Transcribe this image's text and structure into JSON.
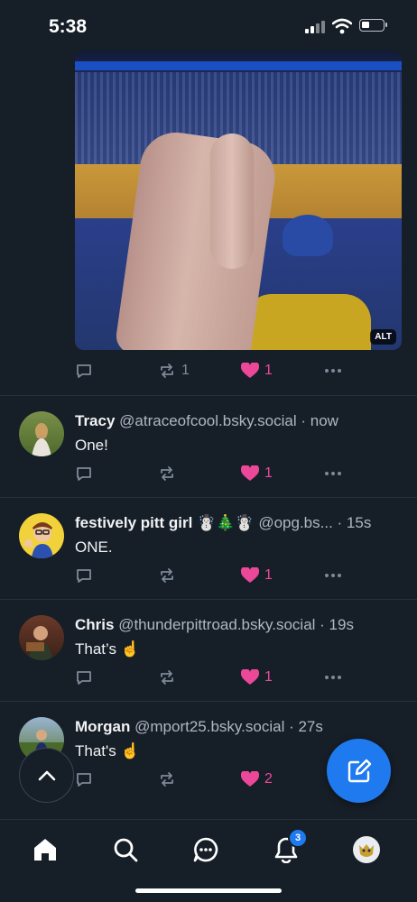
{
  "status_bar": {
    "time": "5:38"
  },
  "media": {
    "alt_badge": "ALT"
  },
  "top_post": {
    "reposts": "1",
    "likes": "1"
  },
  "replies": [
    {
      "name": "Tracy",
      "handle": "@atraceofcool.bsky.social",
      "time": "· now",
      "text": "One!",
      "likes": "1"
    },
    {
      "name": "festively pitt girl ☃️🎄☃️",
      "handle": "@opg.bs...",
      "time": "· 15s",
      "text": "ONE.",
      "likes": "1"
    },
    {
      "name": "Chris",
      "handle": "@thunderpittroad.bsky.social",
      "time": "· 19s",
      "text": "That’s ☝️",
      "likes": "1"
    },
    {
      "name": "Morgan",
      "handle": "@mport25.bsky.social",
      "time": "· 27s",
      "text": "That's ☝️",
      "likes": "2"
    }
  ],
  "nav": {
    "notifications_badge": "3"
  },
  "colors": {
    "background": "#161e27",
    "accent": "#1f7af0",
    "like": "#ec4899",
    "muted": "#7d8a99"
  },
  "icons": [
    "reply-icon",
    "repost-icon",
    "heart-icon",
    "more-icon",
    "compose-icon",
    "scroll-up-icon",
    "home-icon",
    "search-icon",
    "chat-icon",
    "bell-icon",
    "profile-avatar"
  ]
}
